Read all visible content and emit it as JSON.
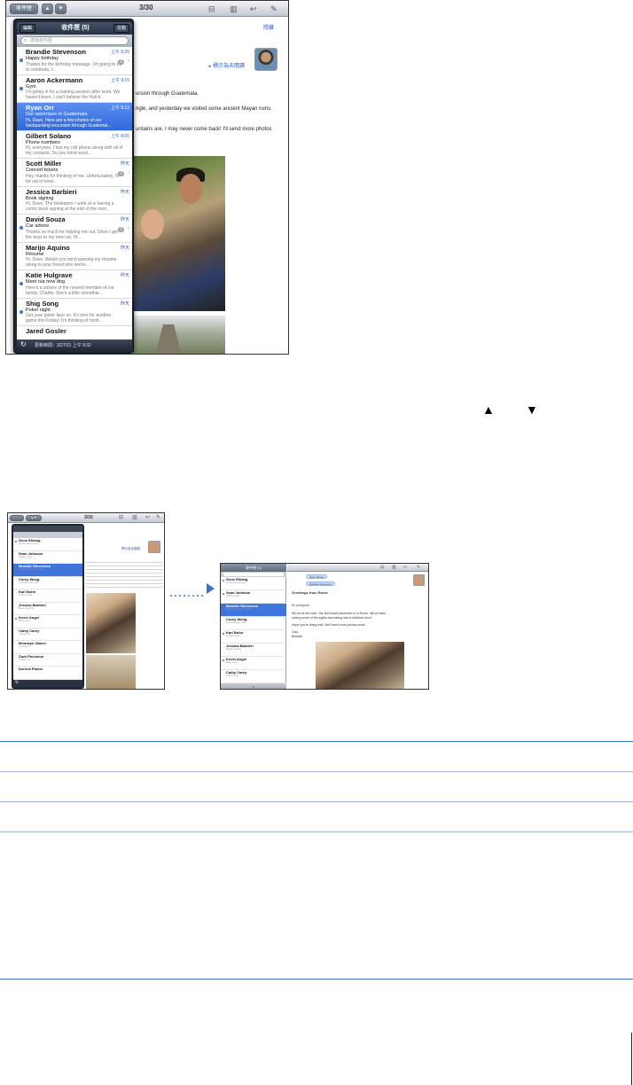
{
  "screenshot_main": {
    "toolbar": {
      "inbox_button": "收件匣",
      "counter": "3/30"
    },
    "message": {
      "header_link": "隱藏",
      "mark_unread": "標示為未閱讀",
      "body_lines": [
        "ursion through Guatemala.",
        "ngle, and yesterday we visited some ancient Mayan ruins.",
        "untains are. I may never come back! I'll send more photos"
      ]
    },
    "popover": {
      "edit_button": "編輯",
      "title": "收件匣 (5)",
      "right_button": "信箱",
      "search_placeholder": "搜尋收件匣",
      "footer": "更新時間：3/27/11 上午 9:32",
      "items": [
        {
          "sender": "Brandie Stevenson",
          "subject": "Happy birthday",
          "preview": "Thanks for the birthday message. I'm going to try to celebrate, I...",
          "time": "上午 9:25",
          "count": "2",
          "unread": true,
          "selected": false
        },
        {
          "sender": "Aaron Ackermann",
          "subject": "Gym",
          "preview": "I'm going in for a training session after work. We haven't been. I can't believe the Hutch...",
          "time": "上午 9:15",
          "count": "",
          "unread": true,
          "selected": false
        },
        {
          "sender": "Ryan Orr",
          "subject": "Our adventure in Guatemala",
          "preview": "Hi, Dave. Here are a few photos of our backpacking excursion through Guatemal...",
          "time": "上午 8:12",
          "count": "",
          "unread": false,
          "selected": true
        },
        {
          "sender": "Gilbert Solano",
          "subject": "Phone numbers",
          "preview": "Hi, everyone. I lost my cell phone along with all of my contacts. Do you mind send...",
          "time": "上午 8:05",
          "count": "",
          "unread": false,
          "selected": false
        },
        {
          "sender": "Scott Miller",
          "subject": "Concert tickets",
          "preview": "Hey, thanks for thinking of me. Unfortunately, I'll be out of town...",
          "time": "昨天",
          "count": "3",
          "unread": false,
          "selected": false
        },
        {
          "sender": "Jessica Barbieri",
          "subject": "Book signing",
          "preview": "Hi, Dave. The bookstore I work at is having a comic book signing at the end of the mon...",
          "time": "昨天",
          "count": "",
          "unread": false,
          "selected": false
        },
        {
          "sender": "David Souza",
          "subject": "Car advice",
          "preview": "Thanks so much for helping me out. Once I get the keys to my new car, I'll...",
          "time": "昨天",
          "count": "2",
          "unread": true,
          "selected": false
        },
        {
          "sender": "Marijo Aquino",
          "subject": "Résumé",
          "preview": "Hi, Dave. Would you mind passing my résumé along to your friend who works...",
          "time": "昨天",
          "count": "",
          "unread": false,
          "selected": false
        },
        {
          "sender": "Katie Hulgrave",
          "subject": "Meet our new dog",
          "preview": "Here's a picture of the newest member of our family, Charlie. She's a little smoothie...",
          "time": "昨天",
          "count": "",
          "unread": true,
          "selected": false
        },
        {
          "sender": "Shig Song",
          "subject": "Poker night",
          "preview": "Get your poker face on. It's time for another game this Friday! I'm thinking of hosti...",
          "time": "昨天",
          "count": "",
          "unread": true,
          "selected": false
        },
        {
          "sender": "Jared Gosler",
          "subject": "",
          "preview": "",
          "time": "",
          "count": "",
          "unread": false,
          "selected": false
        }
      ]
    }
  },
  "screenshot_small_left": {
    "counter": "3/30",
    "mark_unread": "標示為未閱讀",
    "items": [
      {
        "sender": "Gene Ehlang",
        "subject": "Commencement",
        "unread": true,
        "selected": false
      },
      {
        "sender": "Sean Johnson",
        "subject": "Office party",
        "unread": false,
        "selected": false
      },
      {
        "sender": "Brandie Stevenson",
        "subject": "Greetings from Rome",
        "unread": false,
        "selected": true
      },
      {
        "sender": "Corey Wong",
        "subject": "Furniture for sale",
        "unread": false,
        "selected": false
      },
      {
        "sender": "Karl Bohn",
        "subject": "Coffee date",
        "unread": false,
        "selected": false
      },
      {
        "sender": "Jessica Barbieri",
        "subject": "Book signing",
        "unread": false,
        "selected": false
      },
      {
        "sender": "Kevin Angel",
        "subject": "Blog post",
        "unread": true,
        "selected": false
      },
      {
        "sender": "Cathy Carey",
        "subject": "Thank you",
        "unread": false,
        "selected": false
      },
      {
        "sender": "Bronwyn James",
        "subject": "Instagram",
        "unread": false,
        "selected": false
      },
      {
        "sender": "Zack Pincheon",
        "subject": "Ticket info",
        "unread": false,
        "selected": false
      },
      {
        "sender": "Derrick Parker",
        "subject": "",
        "unread": false,
        "selected": false
      }
    ]
  },
  "screenshot_small_right": {
    "sidebar_title": "收件匣 (1)",
    "recipients": [
      "Ryan Moran",
      "Brandie Stevenson"
    ],
    "greeting_title": "Greetings from Rome",
    "body_salutation": "Hi, everyone.",
    "body_lines": [
      "We've hit the road. Our first travel adventure is in Rome. We've been",
      "seeing some of the sights and eating lots of delicious food.",
      "Hope you're doing well. We'll send more photos soon!"
    ],
    "signoff": "Ciao,",
    "signature": "Brandie",
    "items": [
      {
        "sender": "Gene Ehlang",
        "subject": "Commencement",
        "unread": true,
        "selected": false
      },
      {
        "sender": "Sean Johnson",
        "subject": "Office party",
        "unread": true,
        "selected": false
      },
      {
        "sender": "Brandie Stevenson",
        "subject": "Greetings from Rome",
        "unread": false,
        "selected": true
      },
      {
        "sender": "Corey Wong",
        "subject": "Furniture for sale",
        "unread": false,
        "selected": false
      },
      {
        "sender": "Karl Bohn",
        "subject": "Coffee date",
        "unread": true,
        "selected": false
      },
      {
        "sender": "Jessica Barbieri",
        "subject": "Book signing",
        "unread": false,
        "selected": false
      },
      {
        "sender": "Kevin Angel",
        "subject": "Blog post",
        "unread": true,
        "selected": false
      },
      {
        "sender": "Cathy Carey",
        "subject": "Thank you",
        "unread": false,
        "selected": false
      }
    ]
  },
  "colors": {
    "accent": "#3b74c5",
    "selection": "#3f74dc",
    "unread_dot": "#3a78dc"
  }
}
